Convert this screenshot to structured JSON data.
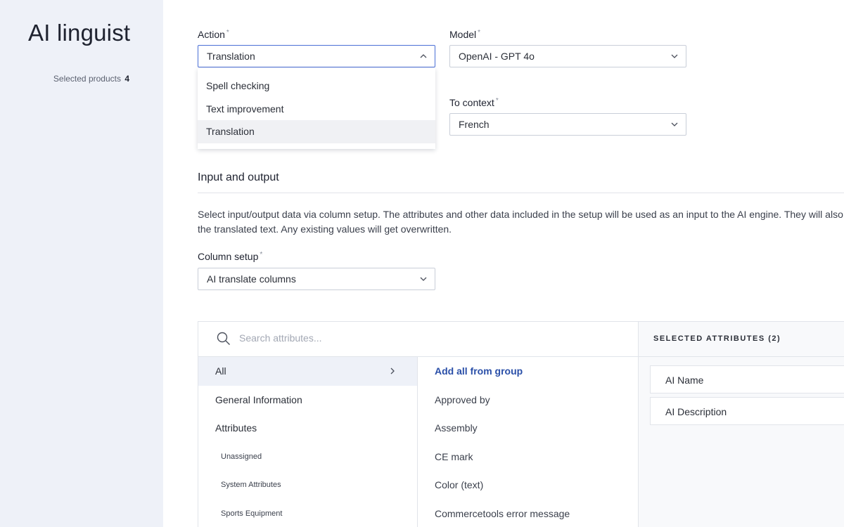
{
  "app": {
    "title": "AI linguist"
  },
  "sidebar": {
    "selected_products_label": "Selected products",
    "selected_products_count": "4"
  },
  "form": {
    "action": {
      "label": "Action",
      "required": "*",
      "value": "Translation",
      "options": [
        "Spell checking",
        "Text improvement",
        "Translation"
      ]
    },
    "model": {
      "label": "Model",
      "required": "*",
      "value": "OpenAI - GPT 4o"
    },
    "to_context": {
      "label": "To context",
      "required": "*",
      "value": "French"
    }
  },
  "io": {
    "title": "Input and output",
    "description_line1": "Select input/output data via column setup. The attributes and other data included in the setup will be used as an input to the AI engine. They will also",
    "description_line2": "the translated text. Any existing values will get overwritten.",
    "column_setup": {
      "label": "Column setup",
      "required": "*",
      "value": "AI translate columns"
    }
  },
  "attributes_panel": {
    "search_placeholder": "Search attributes...",
    "selected_header": "SELECTED ATTRIBUTES (2)",
    "groups": [
      {
        "label": "All",
        "level": "top"
      },
      {
        "label": "General Information",
        "level": "top"
      },
      {
        "label": "Attributes",
        "level": "top"
      },
      {
        "label": "Unassigned",
        "level": "sub"
      },
      {
        "label": "System Attributes",
        "level": "sub"
      },
      {
        "label": "Sports Equipment",
        "level": "sub"
      }
    ],
    "add_all_label": "Add all from group",
    "attributes": [
      "Approved by",
      "Assembly",
      "CE mark",
      "Color (text)",
      "Commercetools error message"
    ],
    "selected": [
      "AI Name",
      "AI Description"
    ]
  },
  "icons": {
    "chevron": "chevron-down-icon",
    "chevron_up": "chevron-up-icon",
    "search": "search-icon",
    "arrow": "chevron-right-icon"
  },
  "colors": {
    "sidebar_bg": "#eef1f8",
    "accent": "#2a4fa8",
    "focus_border": "#4a6fd6"
  }
}
